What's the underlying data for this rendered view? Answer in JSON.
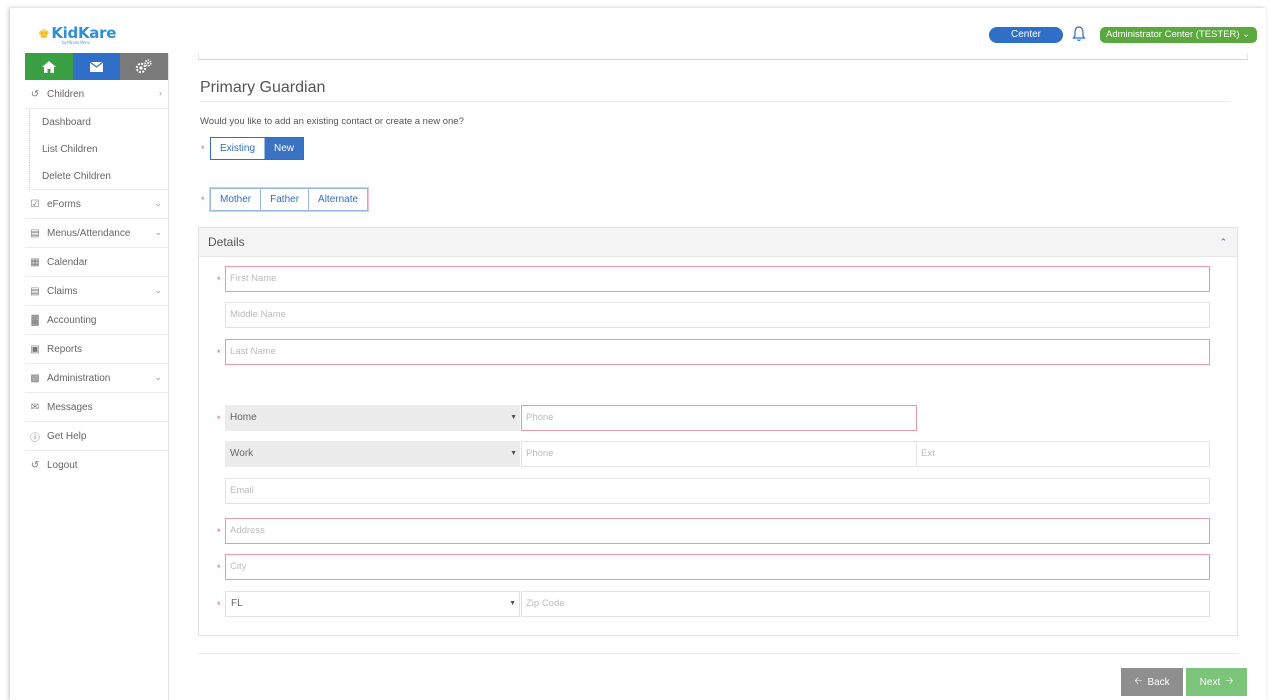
{
  "header": {
    "logo_text": "KidKare",
    "logo_byline": "by Minute Menu",
    "center_label": "Center",
    "user_label": "Administrator Center (TESTER)"
  },
  "sidebar": {
    "icons": [
      "home-icon",
      "mail-icon",
      "gears-icon"
    ],
    "children": {
      "label": "Children",
      "sub": [
        "Dashboard",
        "List Children",
        "Delete Children"
      ]
    },
    "items": [
      {
        "label": "eForms",
        "icon": "form-check-icon",
        "chevron": true
      },
      {
        "label": "Menus/Attendance",
        "icon": "menu-icon",
        "chevron": true
      },
      {
        "label": "Calendar",
        "icon": "calendar-icon",
        "chevron": false
      },
      {
        "label": "Claims",
        "icon": "claims-icon",
        "chevron": true
      },
      {
        "label": "Accounting",
        "icon": "accounting-icon",
        "chevron": false
      },
      {
        "label": "Reports",
        "icon": "reports-icon",
        "chevron": false
      },
      {
        "label": "Administration",
        "icon": "administration-icon",
        "chevron": true
      },
      {
        "label": "Messages",
        "icon": "messages-icon",
        "chevron": false
      },
      {
        "label": "Get Help",
        "icon": "help-icon",
        "chevron": false
      },
      {
        "label": "Logout",
        "icon": "logout-icon",
        "chevron": false
      }
    ]
  },
  "main": {
    "title": "Primary Guardian",
    "question": "Would you like to add an existing contact or create a new one?",
    "contact_mode": {
      "options": [
        "Existing",
        "New"
      ],
      "selected": "New"
    },
    "relationship": {
      "options": [
        "Mother",
        "Father",
        "Alternate"
      ]
    },
    "details": {
      "heading": "Details",
      "first_name": "First Name",
      "middle_name": "Middle Name",
      "last_name": "Last Name",
      "phone1_type": "Home",
      "phone1": "Phone",
      "phone2_type": "Work",
      "phone2": "Phone",
      "ext": "Ext",
      "email": "Email",
      "address": "Address",
      "city": "City",
      "state": "FL",
      "zip": "Zip Code"
    },
    "buttons": {
      "back": "Back",
      "next": "Next"
    }
  },
  "colors": {
    "primary_blue": "#2f6fc7",
    "green": "#5aa83e",
    "required_pink": "#e89aac",
    "next_green": "#7bc47a",
    "back_gray": "#8f8f8f"
  }
}
